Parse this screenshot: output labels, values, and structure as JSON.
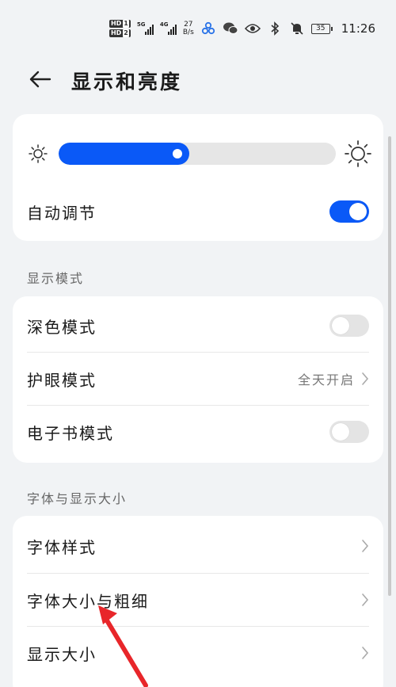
{
  "status_bar": {
    "hd1": "HD",
    "hd1_sub": "1",
    "hd2": "HD",
    "hd2_sub": "2",
    "signal1_label": "5G",
    "signal2_label": "4G",
    "speed_value": "27",
    "speed_unit": "B/s",
    "battery": "35",
    "time": "11:26",
    "icons": [
      "app-icon",
      "wechat-icon",
      "eye-icon",
      "bluetooth-icon",
      "mute-icon",
      "battery-icon"
    ]
  },
  "header": {
    "title": "显示和亮度",
    "back_icon": "back-arrow-icon"
  },
  "brightness": {
    "level_percent": 47,
    "auto_label": "自动调节",
    "auto_on": true
  },
  "display_mode": {
    "section_title": "显示模式",
    "dark_mode_label": "深色模式",
    "dark_mode_on": false,
    "eye_comfort_label": "护眼模式",
    "eye_comfort_value": "全天开启",
    "ebook_label": "电子书模式",
    "ebook_on": false
  },
  "font_display": {
    "section_title": "字体与显示大小",
    "font_style_label": "字体样式",
    "font_size_weight_label": "字体大小与粗细",
    "display_size_label": "显示大小"
  },
  "colors": {
    "accent": "#0a59f7",
    "annotation": "#e8262a",
    "background": "#f1f3f5"
  }
}
